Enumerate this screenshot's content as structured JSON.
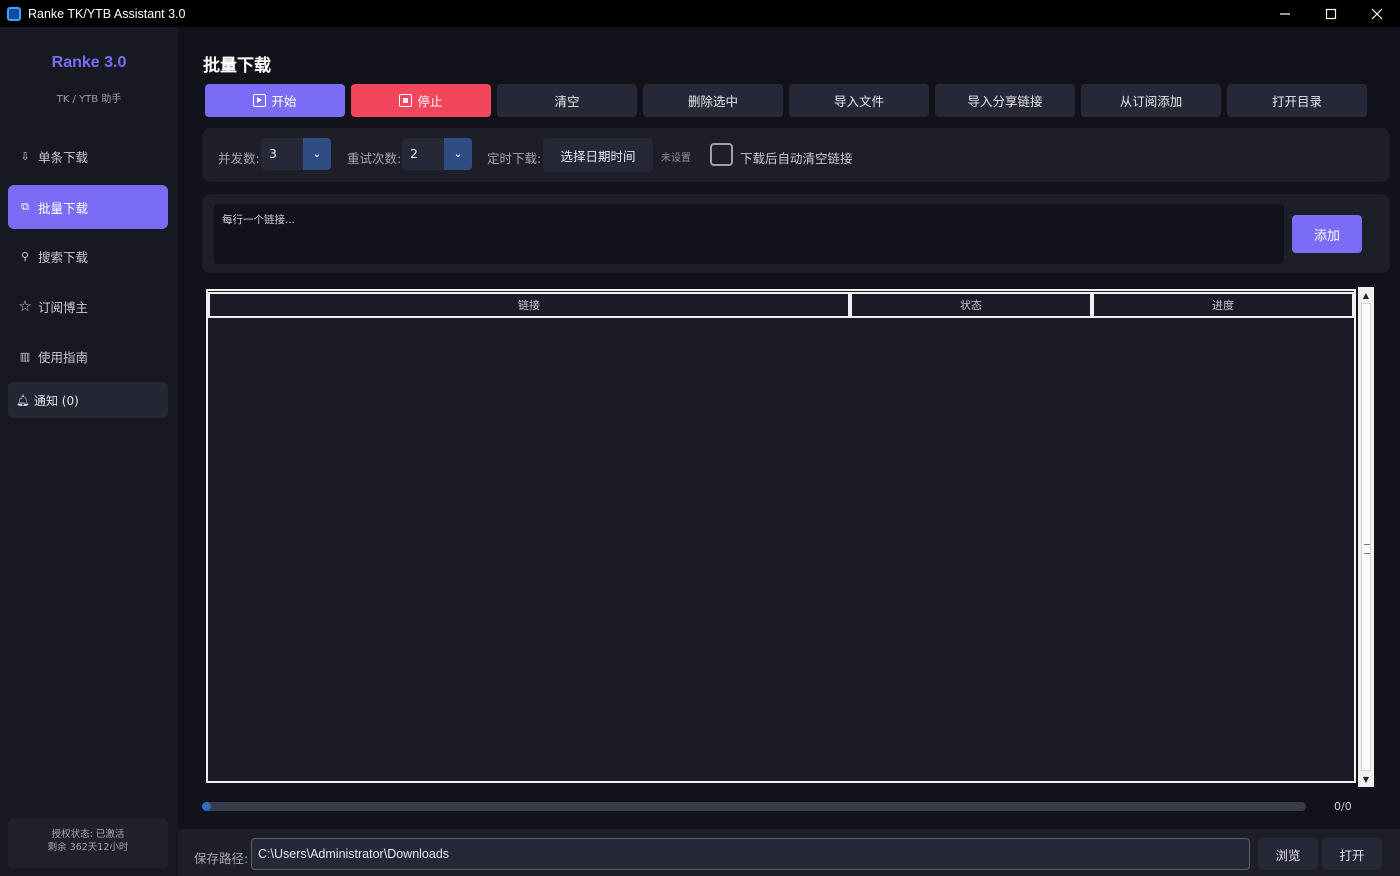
{
  "window": {
    "title": "Ranke TK/YTB Assistant 3.0"
  },
  "sidebar": {
    "brand": "Ranke 3.0",
    "subtitle": "TK / YTB 助手",
    "items": [
      {
        "label": "单条下载",
        "icon": "download-icon"
      },
      {
        "label": "批量下载",
        "icon": "copy-icon",
        "active": true
      },
      {
        "label": "搜索下载",
        "icon": "search-icon"
      },
      {
        "label": "订阅博主",
        "icon": "star-icon"
      },
      {
        "label": "使用指南",
        "icon": "book-icon"
      }
    ],
    "notification": "通知 (0)",
    "license_status": "授权状态: 已激活",
    "license_remaining": "剩余 362天12小时"
  },
  "main": {
    "title": "批量下载",
    "toolbar": {
      "start": "开始",
      "stop": "停止",
      "clear": "清空",
      "delete_selected": "删除选中",
      "import_file": "导入文件",
      "import_share": "导入分享链接",
      "add_from_sub": "从订阅添加",
      "open_dir": "打开目录"
    },
    "options": {
      "concurrency_label": "并发数:",
      "concurrency_value": "3",
      "retry_label": "重试次数:",
      "retry_value": "2",
      "schedule_label": "定时下载:",
      "schedule_button": "选择日期时间",
      "schedule_status": "未设置",
      "auto_clear_label": "下载后自动清空链接",
      "auto_clear_checked": false
    },
    "add": {
      "placeholder": "每行一个链接...",
      "button": "添加"
    },
    "table": {
      "columns": [
        "链接",
        "状态",
        "进度"
      ],
      "rows": []
    },
    "progress": {
      "value": 0,
      "text": "0/0"
    },
    "footer": {
      "path_label": "保存路径:",
      "path_value": "C:\\Users\\Administrator\\Downloads",
      "browse": "浏览",
      "open": "打开"
    }
  },
  "colors": {
    "accent": "#7b6cf6",
    "danger": "#f2465c",
    "background": "#12131a",
    "panel": "#1d1e28"
  }
}
